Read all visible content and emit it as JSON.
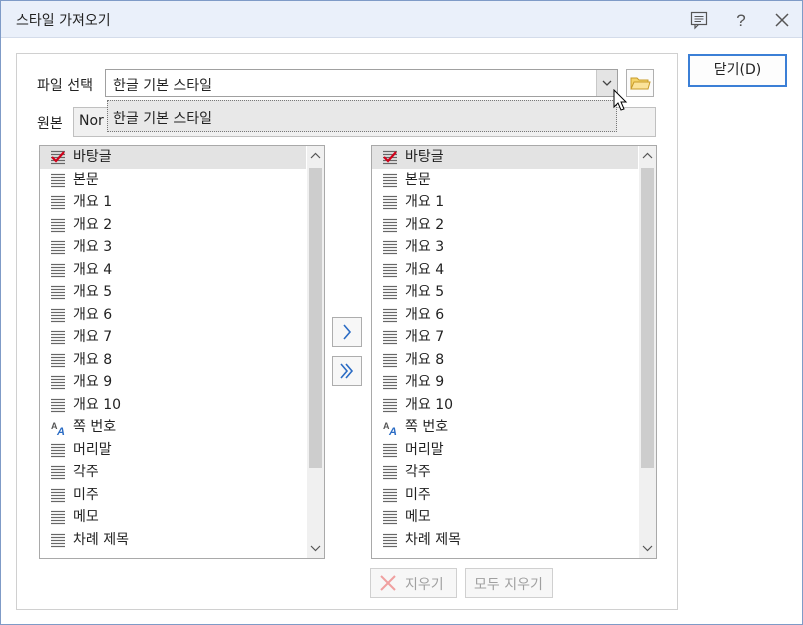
{
  "window": {
    "title": "스타일 가져오기"
  },
  "file_select": {
    "label": "파일 선택",
    "value": "한글 기본 스타일"
  },
  "source": {
    "label": "원본",
    "value": "Nor"
  },
  "dropdown": {
    "option": "한글 기본 스타일"
  },
  "styles": [
    {
      "name": "바탕글",
      "icon": "check-style-icon"
    },
    {
      "name": "본문",
      "icon": "paragraph-style-icon"
    },
    {
      "name": "개요 1",
      "icon": "paragraph-style-icon"
    },
    {
      "name": "개요 2",
      "icon": "paragraph-style-icon"
    },
    {
      "name": "개요 3",
      "icon": "paragraph-style-icon"
    },
    {
      "name": "개요 4",
      "icon": "paragraph-style-icon"
    },
    {
      "name": "개요 5",
      "icon": "paragraph-style-icon"
    },
    {
      "name": "개요 6",
      "icon": "paragraph-style-icon"
    },
    {
      "name": "개요 7",
      "icon": "paragraph-style-icon"
    },
    {
      "name": "개요 8",
      "icon": "paragraph-style-icon"
    },
    {
      "name": "개요 9",
      "icon": "paragraph-style-icon"
    },
    {
      "name": "개요 10",
      "icon": "paragraph-style-icon"
    },
    {
      "name": "쪽 번호",
      "icon": "character-style-icon"
    },
    {
      "name": "머리말",
      "icon": "paragraph-style-icon"
    },
    {
      "name": "각주",
      "icon": "paragraph-style-icon"
    },
    {
      "name": "미주",
      "icon": "paragraph-style-icon"
    },
    {
      "name": "메모",
      "icon": "paragraph-style-icon"
    },
    {
      "name": "차례 제목",
      "icon": "paragraph-style-icon"
    }
  ],
  "buttons": {
    "delete": "지우기",
    "delete_all": "모두 지우기",
    "close": "닫기(D)",
    "move_one": "chevron-right-icon",
    "move_all": "double-chevron-right-icon"
  },
  "colors": {
    "accent": "#3b7fd6",
    "check": "#d0021b",
    "selection": "#e3e3e3"
  }
}
